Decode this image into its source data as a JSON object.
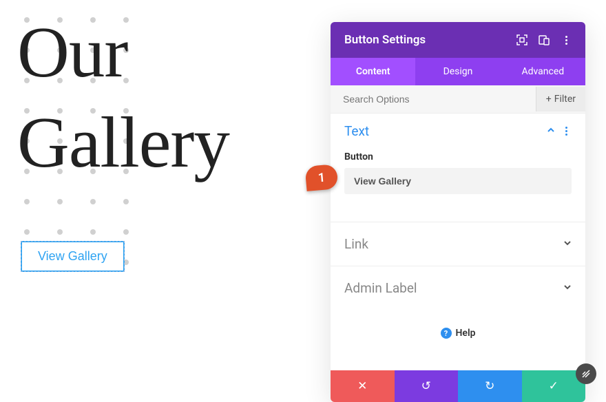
{
  "canvas": {
    "heading_line1": "Our",
    "heading_line2": "Gallery",
    "button_label": "View Gallery"
  },
  "panel": {
    "title": "Button Settings",
    "tabs": {
      "content": "Content",
      "design": "Design",
      "advanced": "Advanced"
    },
    "search_placeholder": "Search Options",
    "filter": "Filter",
    "sections": {
      "text": {
        "title": "Text",
        "field_label": "Button",
        "field_value": "View Gallery"
      },
      "link": {
        "title": "Link"
      },
      "admin": {
        "title": "Admin Label"
      }
    },
    "help": "Help"
  },
  "callout": "1"
}
